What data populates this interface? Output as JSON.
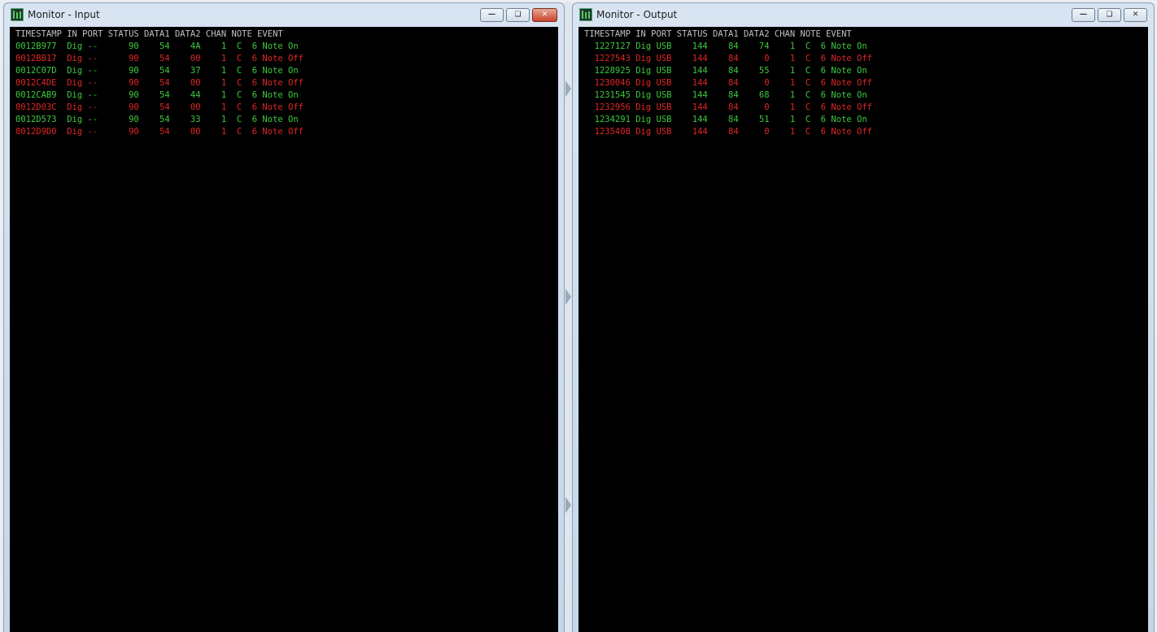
{
  "windows": {
    "input": {
      "title": "Monitor - Input",
      "header": "TIMESTAMP IN PORT STATUS DATA1 DATA2 CHAN NOTE EVENT",
      "rows": [
        {
          "text": "0012B977  Dig --      90    54    4A    1  C  6 Note On",
          "state": "on"
        },
        {
          "text": "0012BB17  Dig --      90    54    00    1  C  6 Note Off",
          "state": "off"
        },
        {
          "text": "0012C07D  Dig --      90    54    37    1  C  6 Note On",
          "state": "on"
        },
        {
          "text": "0012C4DE  Dig --      90    54    00    1  C  6 Note Off",
          "state": "off"
        },
        {
          "text": "0012CAB9  Dig --      90    54    44    1  C  6 Note On",
          "state": "on"
        },
        {
          "text": "0012D03C  Dig --      90    54    00    1  C  6 Note Off",
          "state": "off"
        },
        {
          "text": "0012D573  Dig --      90    54    33    1  C  6 Note On",
          "state": "on"
        },
        {
          "text": "0012D9D0  Dig --      90    54    00    1  C  6 Note Off",
          "state": "off"
        }
      ]
    },
    "output": {
      "title": "Monitor - Output",
      "header": "TIMESTAMP IN PORT STATUS DATA1 DATA2 CHAN NOTE EVENT",
      "rows": [
        {
          "text": "  1227127 Dig USB    144    84    74    1  C  6 Note On",
          "state": "on"
        },
        {
          "text": "  1227543 Dig USB    144    84     0    1  C  6 Note Off",
          "state": "off"
        },
        {
          "text": "  1228925 Dig USB    144    84    55    1  C  6 Note On",
          "state": "on"
        },
        {
          "text": "  1230046 Dig USB    144    84     0    1  C  6 Note Off",
          "state": "off"
        },
        {
          "text": "  1231545 Dig USB    144    84    68    1  C  6 Note On",
          "state": "on"
        },
        {
          "text": "  1232956 Dig USB    144    84     0    1  C  6 Note Off",
          "state": "off"
        },
        {
          "text": "  1234291 Dig USB    144    84    51    1  C  6 Note On",
          "state": "on"
        },
        {
          "text": "  1235408 Dig USB    144    84     0    1  C  6 Note Off",
          "state": "off"
        }
      ]
    }
  },
  "icons": {
    "app": "midi-monitor-icon",
    "minimize": "minimize-icon",
    "maximize": "maximize-icon",
    "close": "close-icon"
  },
  "colors": {
    "note_on": "#3ec93e",
    "note_off": "#e02525",
    "header": "#c0c0c0",
    "background": "#000000"
  }
}
